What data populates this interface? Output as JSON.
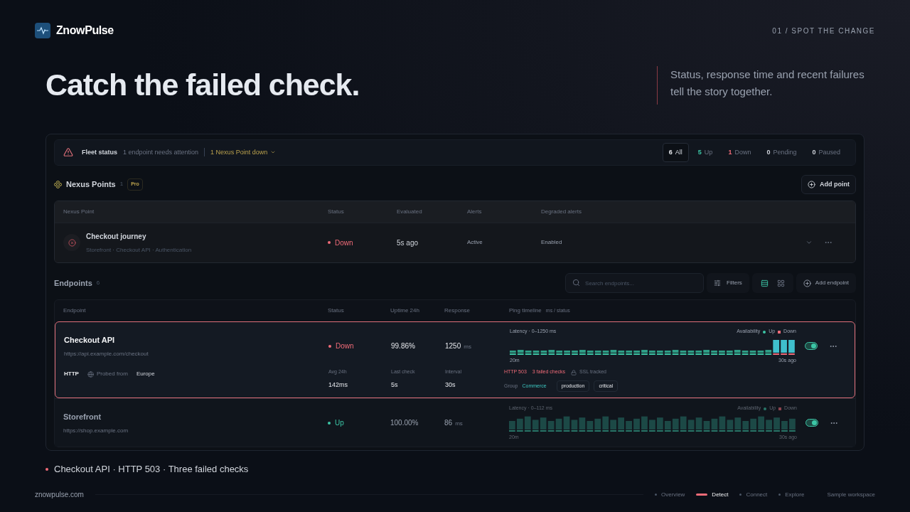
{
  "brand": "ZnowPulse",
  "step_label": "01 / SPOT THE CHANGE",
  "headline": "Catch the failed check.",
  "subtitle": "Status, response time and recent failures tell the story together.",
  "fleet": {
    "title": "Fleet status",
    "message": "1 endpoint needs attention",
    "nexus_down": "1 Nexus Point down"
  },
  "counts": [
    {
      "value": "6",
      "label": "All",
      "kind": "all",
      "selected": true
    },
    {
      "value": "5",
      "label": "Up",
      "kind": "up",
      "selected": false
    },
    {
      "value": "1",
      "label": "Down",
      "kind": "down",
      "selected": false
    },
    {
      "value": "0",
      "label": "Pending",
      "kind": "neutral",
      "selected": false
    },
    {
      "value": "0",
      "label": "Paused",
      "kind": "neutral",
      "selected": false
    }
  ],
  "nexus": {
    "title": "Nexus Points",
    "count": "1",
    "badge": "Pro",
    "add_button": "Add point",
    "columns": [
      "Nexus Point",
      "Status",
      "Evaluated",
      "Alerts",
      "Degraded alerts"
    ],
    "rows": [
      {
        "name": "Checkout journey",
        "members": "Storefront · Checkout API · Authentication",
        "status": "Down",
        "color": "#f06b78",
        "evaluated": "5s ago",
        "alerts": "Active",
        "degraded": "Enabled"
      }
    ]
  },
  "endpoints": {
    "title": "Endpoints",
    "count": "6",
    "search_placeholder": "Search endpoints...",
    "filters": "Filters",
    "views": [
      {
        "kind": "list",
        "selected": true
      },
      {
        "kind": "grid",
        "selected": false
      }
    ],
    "add_button": "Add endpoint",
    "columns": [
      "Endpoint",
      "Status",
      "Uptime 24h",
      "Response",
      "Ping timeline"
    ],
    "timeline_unit": "ms / status",
    "rows": [
      {
        "name": "Checkout API",
        "url": "https://api.example.com/checkout",
        "status": "Down",
        "color": "#f06b78",
        "kind": "failing",
        "selected": true,
        "uptime": "99.86%",
        "response": "1250",
        "unit": "ms",
        "latency_label": "Latency · 0–1250 ms",
        "availability": "Availability",
        "up_label": "Up",
        "down_label": "Down",
        "start": "20m",
        "end": "30s ago",
        "on": true,
        "details": {
          "protocol": "HTTP",
          "probed_label": "Probed from",
          "region": "Europe",
          "stats": [
            {
              "label": "Avg 24h",
              "value": "142ms"
            },
            {
              "label": "Last check",
              "value": "5s"
            },
            {
              "label": "Interval",
              "value": "30s"
            }
          ],
          "error": "HTTP 503",
          "failed": "3 failed checks",
          "ssl": "SSL tracked",
          "group_label": "Group",
          "group": "Commerce",
          "tags": [
            "production",
            "critical"
          ]
        }
      },
      {
        "name": "Storefront",
        "url": "https://shop.example.com",
        "status": "Up",
        "color": "#3cc6a6",
        "kind": "healthy",
        "selected": false,
        "uptime": "100.00%",
        "response": "86",
        "unit": "ms",
        "latency_label": "Latency · 0–112 ms",
        "availability": "Availability",
        "up_label": "Up",
        "down_label": "Down",
        "start": "20m",
        "end": "30s ago",
        "on": true
      }
    ]
  },
  "callout": "Checkout API · HTTP 503 · Three failed checks",
  "footer": {
    "site": "znowpulse.com",
    "nav": [
      {
        "label": "Overview",
        "selected": false
      },
      {
        "label": "Detect",
        "selected": true
      },
      {
        "label": "Connect",
        "selected": false
      },
      {
        "label": "Explore",
        "selected": false
      }
    ],
    "workspace": "Sample workspace"
  }
}
